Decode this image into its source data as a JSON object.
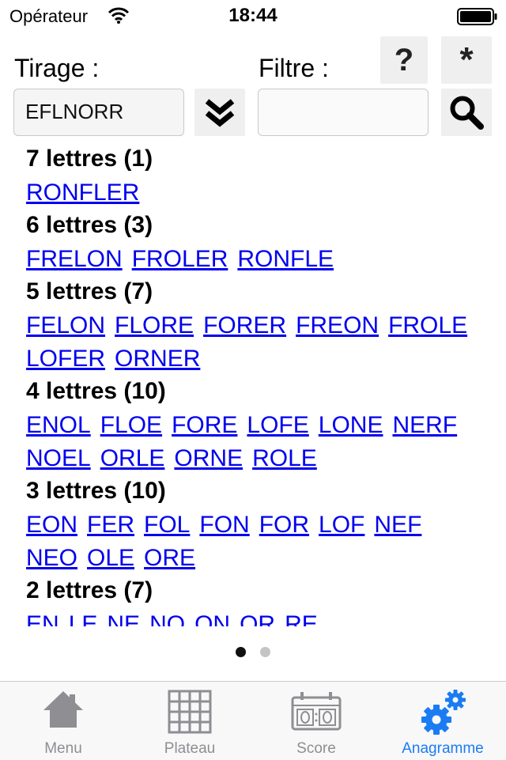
{
  "status_bar": {
    "carrier": "Opérateur",
    "time": "18:44"
  },
  "form": {
    "tirage_label": "Tirage :",
    "tirage_value": "EFLNORR",
    "filtre_label": "Filtre :",
    "filtre_value": "",
    "help_label": "?",
    "star_label": "*"
  },
  "results": [
    {
      "title": "7 lettres (1)",
      "lines": [
        [
          "RONFLER"
        ]
      ]
    },
    {
      "title": "6 lettres (3)",
      "lines": [
        [
          "FRELON",
          "FROLER",
          "RONFLE"
        ]
      ]
    },
    {
      "title": "5 lettres (7)",
      "lines": [
        [
          "FELON",
          "FLORE",
          "FORER",
          "FREON",
          "FROLE"
        ],
        [
          "LOFER",
          "ORNER"
        ]
      ]
    },
    {
      "title": "4 lettres (10)",
      "lines": [
        [
          "ENOL",
          "FLOE",
          "FORE",
          "LOFE",
          "LONE",
          "NERF"
        ],
        [
          "NOEL",
          "ORLE",
          "ORNE",
          "ROLE"
        ]
      ]
    },
    {
      "title": "3 lettres (10)",
      "lines": [
        [
          "EON",
          "FER",
          "FOL",
          "FON",
          "FOR",
          "LOF",
          "NEF"
        ],
        [
          "NEO",
          "OLE",
          "ORE"
        ]
      ]
    },
    {
      "title": "2 lettres (7)",
      "lines": [
        [
          "EN",
          "LE",
          "NE",
          "NO",
          "ON",
          "OR",
          "RE"
        ]
      ]
    }
  ],
  "pager": {
    "current": 1,
    "total": 2
  },
  "tabs": [
    {
      "label": "Menu",
      "icon": "home-icon",
      "active": false
    },
    {
      "label": "Plateau",
      "icon": "grid-icon",
      "active": false
    },
    {
      "label": "Score",
      "icon": "scoreboard-icon",
      "active": false
    },
    {
      "label": "Anagramme",
      "icon": "gears-icon",
      "active": true
    }
  ],
  "colors": {
    "link": "#0000ee",
    "accent": "#1a7cf2",
    "tab_inactive": "#8e8e93",
    "button_bg": "#efefef"
  }
}
